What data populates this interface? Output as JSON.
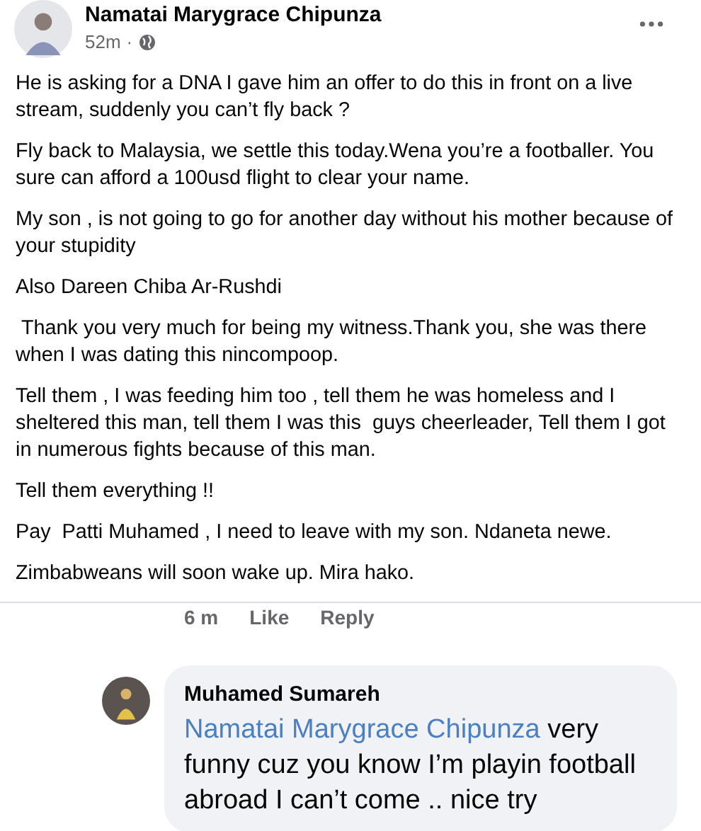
{
  "post": {
    "author": "Namatai Marygrace Chipunza",
    "time": "52m",
    "separator": "·",
    "paragraphs": [
      "He is asking for a DNA I gave him an offer to do this in front on a live stream, suddenly you can’t fly back ?",
      "Fly back to Malaysia, we settle this today.Wena you’re a footballer. You sure can afford a 100usd flight to clear your name.",
      "My son , is not going to go for another day without his mother because of your stupidity",
      "Also Dareen Chiba Ar-Rushdi",
      " Thank you very much for being my witness.Thank you, she was there when I was dating this nincompoop.",
      "Tell them , I was feeding him too , tell them he was homeless and I sheltered this man, tell them I was this  guys cheerleader, Tell them I got in numerous fights because of this man.",
      "Tell them everything !!",
      "Pay  Patti Muhamed , I need to leave with my son. Ndaneta newe.",
      "Zimbabweans will soon wake up. Mira hako."
    ]
  },
  "actions": {
    "time": "6 m",
    "like": "Like",
    "reply": "Reply"
  },
  "comment": {
    "author": "Muhamed Sumareh",
    "mention": "Namatai Marygrace Chipunza",
    "text": "very funny cuz you know I’m playin football abroad I can’t come .. nice try"
  }
}
